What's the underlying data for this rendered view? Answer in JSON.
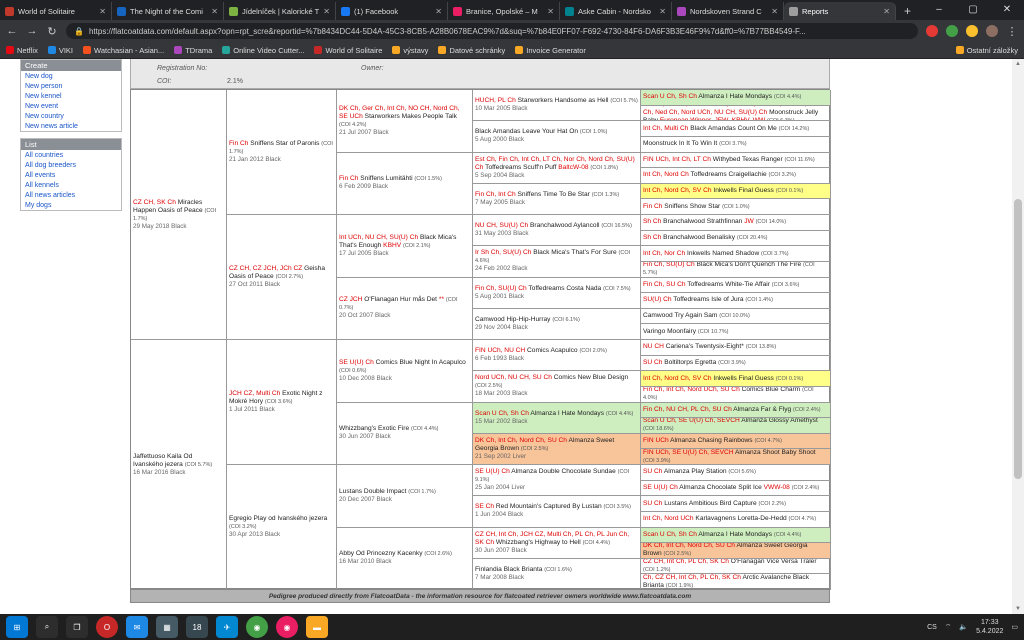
{
  "browser": {
    "tabs": [
      {
        "title": "World of Solitaire",
        "color": "#c0392b"
      },
      {
        "title": "The Night of the Comi",
        "color": "#1565c0"
      },
      {
        "title": "Jídelníček | Kalorické T",
        "color": "#7cb342"
      },
      {
        "title": "(1) Facebook",
        "color": "#1877f2"
      },
      {
        "title": "Branice, Opolské – M",
        "color": "#e91e63"
      },
      {
        "title": "Aske Cabin - Nordsko",
        "color": "#00838f"
      },
      {
        "title": "Nordskoven Strand C",
        "color": "#ab47bc"
      },
      {
        "title": "Reports",
        "color": "#9e9e9e",
        "active": true
      }
    ],
    "newtab": "+",
    "url": "https://flatcoatdata.com/default.aspx?opn=rpt_scre&reportid=%7b8434DC44-5D4A-45C3-8CB5-A28B0678EAC9%7d&suq=%7b84E0FF07-F692-4730-84F6-DA6F3B3E46F9%7d&ff0=%7B77BB4549-F...",
    "bookmarks": [
      "Netflix",
      "VIKI",
      "Watchasian - Asian...",
      "TDrama",
      "Online Video Cutter...",
      "World of Solitaire",
      "výstavy",
      "Datové schránky",
      "Invoice Generator"
    ],
    "other_bookmarks": "Ostatní záložky"
  },
  "sidebar": {
    "create_title": "Create",
    "create": [
      "New dog",
      "New person",
      "New kennel",
      "New event",
      "New country",
      "New news article"
    ],
    "list_title": "List",
    "list": [
      "All countries",
      "All dog breeders",
      "All events",
      "All kennels",
      "All news articles",
      "My dogs"
    ]
  },
  "header": {
    "reg_label": "Registration No:",
    "owner_label": "Owner:",
    "coi_label": "COI:",
    "coi_value": "2.1%"
  },
  "g1": [
    {
      "titles": "",
      "name": "Jaffettuoso Kaila Od Ivanského jezera",
      "coi": "(COI 5.7%)",
      "info": "16 Mar 2016 Black"
    }
  ],
  "g1_dam_placeholder": "",
  "g2": [
    {
      "titles": "CZ CH, SK Ch",
      "name": "Miracles Happen Oasis of Peace",
      "coi": "(COI 1.7%)",
      "info": "29 May 2018 Black"
    },
    {
      "titles": "",
      "name": "Jaffettuoso Kaila Od Ivanského jezera",
      "coi": "(COI 5.7%)",
      "info": "16 Mar 2016 Black"
    }
  ],
  "g3": [
    {
      "titles": "Fin Ch",
      "name": "Sniffens Star of Paronis",
      "coi": "(COI 1.7%)",
      "info": "21 Jan 2012 Black"
    },
    {
      "titles": "CZ CH, CZ JCH, JCh CZ",
      "name": "Geisha Oasis of Peace",
      "coi": "(COI 2.7%)",
      "info": "27 Oct 2011 Black"
    },
    {
      "titles": "JCH CZ, Multi Ch",
      "name": "Exotic Night z Mokré Hory",
      "coi": "(COI 3.6%)",
      "info": "1 Jul 2011 Black"
    },
    {
      "titles": "",
      "name": "Egregio Play od Ivanského jezera",
      "coi": "(COI 3.2%)",
      "info": "30 Apr 2013 Black"
    }
  ],
  "g4": [
    {
      "titles": "DK Ch, Ger Ch, Int Ch, NO CH, Nord Ch, SE UCh",
      "name": "Starworkers Makes People Talk",
      "coi": "(COI 4.2%)",
      "info": "21 Jul 2007 Black"
    },
    {
      "titles": "Fin Ch",
      "name": "Sniffens Lumitähti",
      "coi": "(COI 1.5%)",
      "info": "6 Feb 2009 Black"
    },
    {
      "titles": "Int UCh, NU CH, SU(U) Ch",
      "name": "Black Mica's That's Enough",
      "titles2": "KBHV",
      "coi": "(COI 2.1%)",
      "info": "17 Jul 2005 Black"
    },
    {
      "titles": "CZ JCH",
      "name": "O'Flanagan Hur mås Det",
      "titles2": "**",
      "coi": "(COI 0.7%)",
      "info": "20 Oct 2007 Black"
    },
    {
      "titles": "SE U(U) Ch",
      "name": "Comics Blue Night In Acapulco",
      "coi": "(COI 0.6%)",
      "info": "10 Dec 2008 Black"
    },
    {
      "titles": "",
      "name": "Whizzbang's Exotic Fire",
      "coi": "(COI 4.4%)",
      "info": "30 Jun 2007 Black"
    },
    {
      "titles": "",
      "name": "Lustans Double Impact",
      "coi": "(COI 1.7%)",
      "info": "20 Dec 2007 Black"
    },
    {
      "titles": "",
      "name": "Abby Od Princezny Kacenky",
      "coi": "(COI 2.6%)",
      "info": "16 Mar 2010 Black"
    }
  ],
  "g5": [
    {
      "titles": "HUCH, PL Ch",
      "name": "Starworkers Handsome as Hell",
      "coi": "(COI 5.7%)",
      "info": "10 Mar 2005 Black"
    },
    {
      "titles": "",
      "name": "Black Amandas Leave Your Hat On",
      "coi": "(COI 1.0%)",
      "info": "5 Aug 2000 Black"
    },
    {
      "titles": "Est Ch, Fin Ch, Int Ch, LT Ch, Nor Ch, Nord Ch, SU(U) Ch",
      "name": "Toffedreams Scuff'n Puff",
      "titles2": "BaltcW-08",
      "coi": "(COI 1.8%)",
      "info": "5 Sep 2004 Black"
    },
    {
      "titles": "Fin Ch, Int Ch",
      "name": "Sniffens Time To Be Star",
      "coi": "(COI 1.3%)",
      "info": "7 May 2005 Black"
    },
    {
      "titles": "NU CH, SU(U) Ch",
      "name": "Branchalwood Aylancoll",
      "coi": "(COI 16.5%)",
      "info": "31 May 2003 Black"
    },
    {
      "titles": "Ir Sh Ch, SU(U) Ch",
      "name": "Black Mica's That's For Sure",
      "coi": "(COI 4.6%)",
      "info": "24 Feb 2002 Black"
    },
    {
      "titles": "Fin Ch, SU(U) Ch",
      "name": "Toffedreams Costa Nada",
      "coi": "(COI 7.5%)",
      "info": "5 Aug 2001 Black"
    },
    {
      "titles": "",
      "name": "Camwood Hip-Hip-Hurray",
      "coi": "(COI 6.1%)",
      "info": "29 Nov 2004 Black"
    },
    {
      "titles": "FIN UCh, NU CH",
      "name": "Comics Acapulco",
      "coi": "(COI 2.0%)",
      "info": "6 Feb 1993 Black"
    },
    {
      "titles": "Nord UCh, NU CH, SU Ch",
      "name": "Comics New Blue Design",
      "coi": "(COI 2.5%)",
      "info": "18 Mar 2003 Black"
    },
    {
      "titles": "Scan U Ch, Sh Ch",
      "name": "Almanza I Hate Mondays",
      "coi": "(COI 4.4%)",
      "info": "15 Mar 2002 Black",
      "bg": "green"
    },
    {
      "titles": "DK Ch, Int Ch, Nord Ch, SU Ch",
      "name": "Almanza Sweet Georgia Brown",
      "coi": "(COI 2.5%)",
      "info": "21 Sep 2002 Liver",
      "bg": "orange"
    },
    {
      "titles": "SE U(U) Ch",
      "name": "Almanza Double Chocolate Sundae",
      "coi": "(COI 9.1%)",
      "info": "25 Jan 2004 Liver"
    },
    {
      "titles": "SE Ch",
      "name": "Red Mountain's Captured By Lustan",
      "coi": "(COI 3.5%)",
      "info": "1 Jun 2004 Black"
    },
    {
      "titles": "CZ CH, Int Ch, JCH CZ, Multi Ch, PL Ch, PL Jun Ch, SK Ch",
      "name": "Whizzbang's Highway to Hell",
      "coi": "(COI 4.4%)",
      "info": "30 Jun 2007 Black"
    },
    {
      "titles": "",
      "name": "Finlandia Black Brianta",
      "coi": "(COI 1.6%)",
      "info": "7 Mar 2008 Black"
    }
  ],
  "g6": [
    {
      "titles": "Scan U Ch, Sh Ch",
      "name": "Almanza I Hate Mondays",
      "coi": "(COI 4.4%)",
      "bg": "green"
    },
    {
      "titles": "CH Ch, DK Ch, Ger VDH Ch, HUVCH, Int UCh, Lux Ch, Multi Ch, Ned Ch, Nord UCh, NU CH, SU(U) Ch",
      "name": "Moonstruck Jelly Baby",
      "titles2": "European Winner, JEW, KBHV, WW",
      "coi": "(COI 6.3%)"
    },
    {
      "titles": "Int Ch, Multi Ch",
      "name": "Black Amandas Count On Me",
      "coi": "(COI 14.2%)"
    },
    {
      "titles": "",
      "name": "Moonstruck In It To Win It",
      "coi": "(COI 3.7%)"
    },
    {
      "titles": "FIN UCh, Int Ch, LT Ch",
      "name": "Withybed Texas Ranger",
      "coi": "(COI 11.6%)"
    },
    {
      "titles": "Int Ch, Nord Ch",
      "name": "Toffedreams Craigellachie",
      "coi": "(COI 3.2%)"
    },
    {
      "titles": "Int Ch, Nord Ch, SV Ch",
      "name": "Inkwells Final Guess",
      "coi": "(COI 0.1%)",
      "bg": "yellow"
    },
    {
      "titles": "Fin Ch",
      "name": "Sniffens Show Star",
      "coi": "(COI 1.0%)"
    },
    {
      "titles": "Sh Ch",
      "name": "Branchalwood Strathfinnan",
      "titles2": "JW",
      "coi": "(COI 14.0%)"
    },
    {
      "titles": "Sh Ch",
      "name": "Branchalwood Benalisky",
      "coi": "(COI 20.4%)"
    },
    {
      "titles": "Int Ch, Nor Ch",
      "name": "Inkwells Named Shadow",
      "coi": "(COI 3.7%)"
    },
    {
      "titles": "Fin Ch, SU(U) Ch",
      "name": "Black Mica's Don't Quench The Fire",
      "coi": "(COI 5.7%)"
    },
    {
      "titles": "Fin Ch, SU Ch",
      "name": "Toffedreams White-Tie Affair",
      "coi": "(COI 3.6%)"
    },
    {
      "titles": "SU(U) Ch",
      "name": "Toffedreams Isle of Jura",
      "coi": "(COI 1.4%)"
    },
    {
      "titles": "",
      "name": "Camwood Try Again Sam",
      "coi": "(COI 10.0%)"
    },
    {
      "titles": "",
      "name": "Varingo Moonfairy",
      "coi": "(COI 10.7%)"
    },
    {
      "titles": "NU CH",
      "name": "Cariena's Twentysix-Eight*",
      "coi": "(COI 13.8%)"
    },
    {
      "titles": "SU Ch",
      "name": "Boltiltorps Egretta",
      "coi": "(COI 3.9%)"
    },
    {
      "titles": "Int Ch, Nord Ch, SV Ch",
      "name": "Inkwells Final Guess",
      "coi": "(COI 0.1%)",
      "bg": "yellow"
    },
    {
      "titles": "Fin Ch, Int Ch, Nord UCh, SU Ch",
      "name": "Comics Blue Charm",
      "coi": "(COI 4.0%)"
    },
    {
      "titles": "Fin Ch, NU CH, PL Ch, SU Ch",
      "name": "Almanza Far & Flyg",
      "coi": "(COI 2.4%)",
      "bg": "green"
    },
    {
      "titles": "Scan U Ch, SE U(U) Ch, SEVCH",
      "name": "Almanza Glossy Amethyst",
      "coi": "(COI 18.6%)",
      "bg": "green"
    },
    {
      "titles": "FIN UCh",
      "name": "Almanza Chasing Rainbows",
      "coi": "(COI 4.7%)",
      "bg": "orange"
    },
    {
      "titles": "FIN UCh, SE U(U) Ch, SEVCH",
      "name": "Almanza Shoot Baby Shoot",
      "coi": "(COI 3.9%)",
      "bg": "orange"
    },
    {
      "titles": "SU Ch",
      "name": "Almanza Play Station",
      "coi": "(COI 5.6%)"
    },
    {
      "titles": "SE U(U) Ch",
      "name": "Almanza Chocolate Split Ice",
      "titles2": "VWW-08",
      "coi": "(COI 2.4%)"
    },
    {
      "titles": "SU Ch",
      "name": "Lustans Ambitious Bird Capture",
      "coi": "(COI 2.2%)"
    },
    {
      "titles": "Int Ch, Nord UCh",
      "name": "Karlavagnens Loretta-De-Hedd",
      "coi": "(COI 4.7%)"
    },
    {
      "titles": "Scan U Ch, Sh Ch",
      "name": "Almanza I Hate Mondays",
      "coi": "(COI 4.4%)",
      "bg": "green"
    },
    {
      "titles": "DK Ch, Int Ch, Nord Ch, SU Ch",
      "name": "Almanza Sweet Georgia Brown",
      "coi": "(COI 2.5%)",
      "bg": "orange"
    },
    {
      "titles": "CZ CH, Int Ch, PL Ch, SK Ch",
      "name": "O'Flanagan Vice Versa Traler",
      "coi": "(COI 1.2%)"
    },
    {
      "titles": "Ch, CZ CH, Int Ch, PL Ch, SK Ch",
      "name": "Arctic Avalanche Black Brianta",
      "coi": "(COI 1.9%)"
    }
  ],
  "footer": "Pedigree produced directly from FlatcoatData - the information resource for flatcoated retriever owners worldwide www.flatcoatdata.com",
  "taskbar": {
    "lang": "CS",
    "time": "17:33",
    "date": "5.4.2022"
  }
}
